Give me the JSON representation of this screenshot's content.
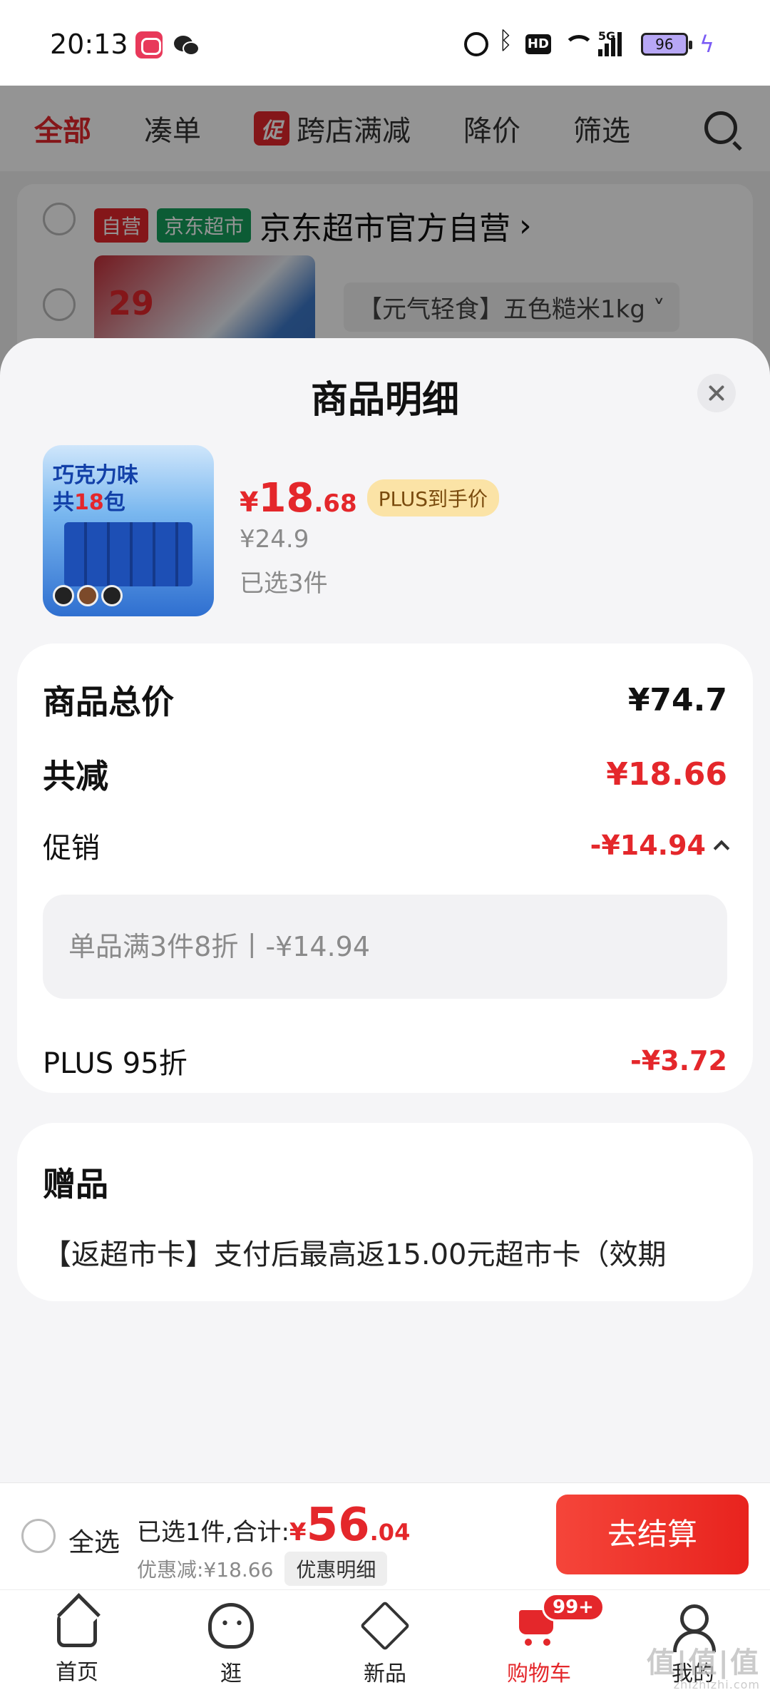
{
  "status_bar": {
    "time": "20:13",
    "network": "5G",
    "battery": "96"
  },
  "background_page": {
    "tabs": [
      "全部",
      "凑单",
      "跨店满减",
      "降价",
      "筛选"
    ],
    "promo_tag": "促",
    "store": {
      "tag_self": "自营",
      "tag_market": "京东超市",
      "name": "京东超市官方自营"
    },
    "product_img_price": "29",
    "spec": "【元气轻食】五色糙米1kg"
  },
  "sheet": {
    "title": "商品明细",
    "product": {
      "thumb_text_line1": "巧克力味",
      "thumb_text_line2_pre": "共",
      "thumb_text_count": "18",
      "thumb_text_line2_post": "包",
      "price_symbol": "¥",
      "price_int": "18",
      "price_dec": ".68",
      "plus_badge": "PLUS到手价",
      "original_price": "¥24.9",
      "selected": "已选3件"
    },
    "breakdown": {
      "total_label": "商品总价",
      "total_value": "¥74.7",
      "reduce_label": "共减",
      "reduce_value": "¥18.66",
      "promo_label": "促销",
      "promo_value": "-¥14.94",
      "promo_detail": "单品满3件8折丨-¥14.94",
      "plus_label": "PLUS 95折",
      "plus_value": "-¥3.72"
    },
    "gift": {
      "title": "赠品",
      "text": "【返超市卡】支付后最高返15.00元超市卡（效期"
    }
  },
  "checkout": {
    "select_all": "全选",
    "summary_prefix": "已选1件,合计:",
    "sum_symbol": "¥",
    "sum_int": "56",
    "sum_dec": ".04",
    "discount": "优惠减:¥18.66",
    "discount_detail": "优惠明细",
    "button": "去结算"
  },
  "tabbar": {
    "items": [
      "首页",
      "逛",
      "新品",
      "购物车",
      "我的"
    ],
    "cart_badge": "99+"
  },
  "watermark": {
    "main": "值|值|值",
    "sub": "zhizhizhi.com"
  },
  "colors": {
    "accent_red": "#e4272b",
    "plus_gold": "#fbe3a6",
    "green_tag": "#159f5c"
  }
}
